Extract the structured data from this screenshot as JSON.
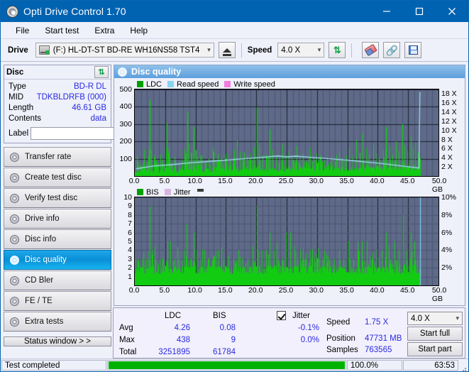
{
  "window": {
    "title": "Opti Drive Control 1.70",
    "app_icon": "disc-icon",
    "minimize": "–",
    "maximize": "□",
    "close": "✕"
  },
  "menu": {
    "items": [
      "File",
      "Start test",
      "Extra",
      "Help"
    ]
  },
  "toolbar": {
    "drive_label": "Drive",
    "drive_value": "(F:)  HL-DT-ST BD-RE  WH16NS58 TST4",
    "eject_icon": "eject-icon",
    "speed_label": "Speed",
    "speed_value": "4.0 X",
    "refresh_icon": "refresh-icon",
    "eraser_icon": "eraser-icon",
    "chain_icon": "chain-icon",
    "save_icon": "save-icon"
  },
  "disc": {
    "header": "Disc",
    "refresh_icon": "refresh-icon",
    "rows": [
      {
        "key": "Type",
        "value": "BD-R DL"
      },
      {
        "key": "MID",
        "value": "TDKBLDRFB (000)"
      },
      {
        "key": "Length",
        "value": "46.61 GB"
      },
      {
        "key": "Contents",
        "value": "data"
      }
    ],
    "label_key": "Label",
    "label_value": "",
    "cd_icon": "cd-icon"
  },
  "sidebar": {
    "items": [
      {
        "label": "Transfer rate",
        "selected": false
      },
      {
        "label": "Create test disc",
        "selected": false
      },
      {
        "label": "Verify test disc",
        "selected": false
      },
      {
        "label": "Drive info",
        "selected": false
      },
      {
        "label": "Disc info",
        "selected": false
      },
      {
        "label": "Disc quality",
        "selected": true
      },
      {
        "label": "CD Bler",
        "selected": false
      },
      {
        "label": "FE / TE",
        "selected": false
      },
      {
        "label": "Extra tests",
        "selected": false
      }
    ],
    "status_button": "Status window > >"
  },
  "quality": {
    "header_icon": "disc-icon",
    "header": "Disc quality"
  },
  "chart_data": [
    {
      "type": "area",
      "title": "LDC / Read speed",
      "xlabel": "GB",
      "ylabel": "LDC",
      "legend": [
        {
          "name": "LDC",
          "color": "#00a000"
        },
        {
          "name": "Read speed",
          "color": "#87d3f0"
        },
        {
          "name": "Write speed",
          "color": "#f07ce0"
        }
      ],
      "legend_position": "top-left",
      "grid": true,
      "xlim": [
        0,
        50
      ],
      "xticks": [
        "0.0",
        "5.0",
        "10.0",
        "15.0",
        "20.0",
        "25.0",
        "30.0",
        "35.0",
        "40.0",
        "45.0",
        "50.0"
      ],
      "xunit": "GB",
      "ylim": [
        0,
        500
      ],
      "yticks": [
        "100",
        "200",
        "300",
        "400",
        "500"
      ],
      "y2lim": [
        0,
        19
      ],
      "y2ticks": [
        "2 X",
        "4 X",
        "6 X",
        "8 X",
        "10 X",
        "12 X",
        "14 X",
        "16 X",
        "18 X"
      ],
      "data_extent_gb": 47.0,
      "ldc": {
        "baseline": 30,
        "peaks": [
          {
            "x": 0.4,
            "y": 120
          },
          {
            "x": 0.9,
            "y": 70
          },
          {
            "x": 1.4,
            "y": 60
          },
          {
            "x": 2.0,
            "y": 80
          },
          {
            "x": 2.45,
            "y": 438
          },
          {
            "x": 2.7,
            "y": 150
          },
          {
            "x": 3.1,
            "y": 110
          },
          {
            "x": 3.6,
            "y": 65
          },
          {
            "x": 4.2,
            "y": 95
          },
          {
            "x": 4.8,
            "y": 60
          },
          {
            "x": 5.3,
            "y": 305
          },
          {
            "x": 5.6,
            "y": 160
          },
          {
            "x": 6.0,
            "y": 75
          },
          {
            "x": 6.6,
            "y": 110
          },
          {
            "x": 7.2,
            "y": 70
          },
          {
            "x": 7.8,
            "y": 95
          },
          {
            "x": 8.2,
            "y": 155
          },
          {
            "x": 8.6,
            "y": 372
          },
          {
            "x": 8.9,
            "y": 190
          },
          {
            "x": 9.3,
            "y": 130
          },
          {
            "x": 9.7,
            "y": 285
          },
          {
            "x": 10.1,
            "y": 150
          },
          {
            "x": 10.5,
            "y": 90
          },
          {
            "x": 11.0,
            "y": 120
          },
          {
            "x": 11.6,
            "y": 75
          },
          {
            "x": 12.2,
            "y": 100
          },
          {
            "x": 12.8,
            "y": 170
          },
          {
            "x": 13.3,
            "y": 85
          },
          {
            "x": 13.9,
            "y": 95
          },
          {
            "x": 14.5,
            "y": 70
          },
          {
            "x": 15.1,
            "y": 130
          },
          {
            "x": 15.6,
            "y": 90
          },
          {
            "x": 16.2,
            "y": 110
          },
          {
            "x": 16.8,
            "y": 205
          },
          {
            "x": 17.3,
            "y": 140
          },
          {
            "x": 17.9,
            "y": 85
          },
          {
            "x": 18.4,
            "y": 120
          },
          {
            "x": 19.0,
            "y": 95
          },
          {
            "x": 19.6,
            "y": 165
          },
          {
            "x": 20.1,
            "y": 395
          },
          {
            "x": 20.5,
            "y": 175
          },
          {
            "x": 21.0,
            "y": 120
          },
          {
            "x": 21.6,
            "y": 95
          },
          {
            "x": 22.2,
            "y": 270
          },
          {
            "x": 22.7,
            "y": 150
          },
          {
            "x": 23.2,
            "y": 110
          },
          {
            "x": 23.8,
            "y": 85
          },
          {
            "x": 24.3,
            "y": 185
          },
          {
            "x": 24.9,
            "y": 120
          },
          {
            "x": 25.4,
            "y": 145
          },
          {
            "x": 26.0,
            "y": 95
          },
          {
            "x": 26.6,
            "y": 175
          },
          {
            "x": 27.1,
            "y": 110
          },
          {
            "x": 27.7,
            "y": 130
          },
          {
            "x": 28.3,
            "y": 90
          },
          {
            "x": 28.9,
            "y": 160
          },
          {
            "x": 29.4,
            "y": 100
          },
          {
            "x": 30.0,
            "y": 75
          },
          {
            "x": 30.6,
            "y": 125
          },
          {
            "x": 31.2,
            "y": 90
          },
          {
            "x": 31.8,
            "y": 70
          },
          {
            "x": 32.4,
            "y": 110
          },
          {
            "x": 33.0,
            "y": 85
          },
          {
            "x": 33.6,
            "y": 140
          },
          {
            "x": 34.2,
            "y": 95
          },
          {
            "x": 34.8,
            "y": 120
          },
          {
            "x": 35.3,
            "y": 170
          },
          {
            "x": 35.9,
            "y": 100
          },
          {
            "x": 36.4,
            "y": 210
          },
          {
            "x": 37.0,
            "y": 135
          },
          {
            "x": 37.5,
            "y": 245
          },
          {
            "x": 38.1,
            "y": 160
          },
          {
            "x": 38.6,
            "y": 110
          },
          {
            "x": 39.2,
            "y": 180
          },
          {
            "x": 39.8,
            "y": 130
          },
          {
            "x": 40.3,
            "y": 95
          },
          {
            "x": 40.9,
            "y": 150
          },
          {
            "x": 41.4,
            "y": 285
          },
          {
            "x": 41.9,
            "y": 170
          },
          {
            "x": 42.4,
            "y": 120
          },
          {
            "x": 43.0,
            "y": 200
          },
          {
            "x": 43.5,
            "y": 145
          },
          {
            "x": 44.0,
            "y": 300
          },
          {
            "x": 44.4,
            "y": 175
          },
          {
            "x": 44.9,
            "y": 120
          },
          {
            "x": 45.4,
            "y": 230
          },
          {
            "x": 45.8,
            "y": 160
          },
          {
            "x": 46.2,
            "y": 195
          },
          {
            "x": 46.6,
            "y": 140
          }
        ]
      },
      "read_speed": {
        "note": "rises 1.6X to ~4.4X near 23GB then declines to ~1.7X at 47GB, vertical jump at end",
        "points": [
          {
            "x": 0.2,
            "y": 1.6
          },
          {
            "x": 3.0,
            "y": 2.2
          },
          {
            "x": 6.0,
            "y": 2.5
          },
          {
            "x": 9.0,
            "y": 2.9
          },
          {
            "x": 12.0,
            "y": 3.2
          },
          {
            "x": 15.0,
            "y": 3.5
          },
          {
            "x": 18.0,
            "y": 3.8
          },
          {
            "x": 21.0,
            "y": 4.1
          },
          {
            "x": 23.5,
            "y": 4.4
          },
          {
            "x": 25.0,
            "y": 4.2
          },
          {
            "x": 26.5,
            "y": 4.35
          },
          {
            "x": 29.0,
            "y": 4.1
          },
          {
            "x": 32.0,
            "y": 3.8
          },
          {
            "x": 35.0,
            "y": 3.5
          },
          {
            "x": 38.0,
            "y": 3.1
          },
          {
            "x": 41.0,
            "y": 2.7
          },
          {
            "x": 44.0,
            "y": 2.2
          },
          {
            "x": 46.8,
            "y": 1.75
          },
          {
            "x": 46.95,
            "y": 18.5
          }
        ]
      }
    },
    {
      "type": "area",
      "title": "BIS / Jitter",
      "xlabel": "GB",
      "ylabel": "BIS",
      "legend": [
        {
          "name": "BIS",
          "color": "#00a000"
        },
        {
          "name": "Jitter",
          "color": "#d8b4e0"
        }
      ],
      "legend_position": "top-left",
      "grid": true,
      "xlim": [
        0,
        50
      ],
      "xticks": [
        "0.0",
        "5.0",
        "10.0",
        "15.0",
        "20.0",
        "25.0",
        "30.0",
        "35.0",
        "40.0",
        "45.0",
        "50.0"
      ],
      "xunit": "GB",
      "ylim": [
        0,
        10
      ],
      "yticks": [
        "1",
        "2",
        "3",
        "4",
        "5",
        "6",
        "7",
        "8",
        "9",
        "10"
      ],
      "y2lim": [
        0,
        10
      ],
      "y2ticks": [
        "2%",
        "4%",
        "6%",
        "8%",
        "10%"
      ],
      "data_extent_gb": 47.0,
      "bis": {
        "baseline": 1.8,
        "peaks": [
          {
            "x": 0.5,
            "y": 3
          },
          {
            "x": 1.2,
            "y": 3
          },
          {
            "x": 1.9,
            "y": 3
          },
          {
            "x": 2.5,
            "y": 9
          },
          {
            "x": 2.9,
            "y": 4
          },
          {
            "x": 3.4,
            "y": 3
          },
          {
            "x": 4.1,
            "y": 3
          },
          {
            "x": 4.7,
            "y": 3
          },
          {
            "x": 5.4,
            "y": 5
          },
          {
            "x": 5.8,
            "y": 5
          },
          {
            "x": 6.5,
            "y": 3
          },
          {
            "x": 7.2,
            "y": 3
          },
          {
            "x": 8.5,
            "y": 7
          },
          {
            "x": 9.1,
            "y": 3
          },
          {
            "x": 9.7,
            "y": 6
          },
          {
            "x": 10.2,
            "y": 4
          },
          {
            "x": 10.9,
            "y": 3
          },
          {
            "x": 11.5,
            "y": 4
          },
          {
            "x": 12.2,
            "y": 3
          },
          {
            "x": 13.0,
            "y": 3
          },
          {
            "x": 13.8,
            "y": 4
          },
          {
            "x": 14.6,
            "y": 3
          },
          {
            "x": 15.4,
            "y": 3
          },
          {
            "x": 16.2,
            "y": 3
          },
          {
            "x": 17.0,
            "y": 4
          },
          {
            "x": 17.8,
            "y": 3
          },
          {
            "x": 18.6,
            "y": 3
          },
          {
            "x": 19.4,
            "y": 3
          },
          {
            "x": 20.1,
            "y": 9
          },
          {
            "x": 20.9,
            "y": 4
          },
          {
            "x": 21.6,
            "y": 4
          },
          {
            "x": 22.2,
            "y": 6
          },
          {
            "x": 22.9,
            "y": 4
          },
          {
            "x": 23.6,
            "y": 3
          },
          {
            "x": 24.3,
            "y": 3
          },
          {
            "x": 24.9,
            "y": 6
          },
          {
            "x": 25.6,
            "y": 6
          },
          {
            "x": 26.4,
            "y": 4
          },
          {
            "x": 27.2,
            "y": 4
          },
          {
            "x": 28.0,
            "y": 3
          },
          {
            "x": 28.8,
            "y": 4
          },
          {
            "x": 29.6,
            "y": 3
          },
          {
            "x": 30.4,
            "y": 3
          },
          {
            "x": 31.2,
            "y": 4
          },
          {
            "x": 32.0,
            "y": 3
          },
          {
            "x": 32.8,
            "y": 3
          },
          {
            "x": 33.6,
            "y": 4
          },
          {
            "x": 34.4,
            "y": 3
          },
          {
            "x": 35.2,
            "y": 5
          },
          {
            "x": 36.0,
            "y": 3
          },
          {
            "x": 36.8,
            "y": 4
          },
          {
            "x": 37.4,
            "y": 5
          },
          {
            "x": 38.2,
            "y": 5
          },
          {
            "x": 39.0,
            "y": 3
          },
          {
            "x": 39.8,
            "y": 4
          },
          {
            "x": 40.6,
            "y": 4
          },
          {
            "x": 41.3,
            "y": 6
          },
          {
            "x": 42.0,
            "y": 3
          },
          {
            "x": 42.7,
            "y": 5
          },
          {
            "x": 43.5,
            "y": 4
          },
          {
            "x": 44.2,
            "y": 8
          },
          {
            "x": 44.8,
            "y": 4
          },
          {
            "x": 45.4,
            "y": 6
          },
          {
            "x": 46.0,
            "y": 5
          },
          {
            "x": 46.5,
            "y": 3
          }
        ]
      }
    }
  ],
  "stats": {
    "col_ldc": "LDC",
    "col_bis": "BIS",
    "jitter_label": "Jitter",
    "jitter_checked": true,
    "rows": [
      {
        "name": "Avg",
        "ldc": "4.26",
        "bis": "0.08",
        "jitter": "-0.1%"
      },
      {
        "name": "Max",
        "ldc": "438",
        "bis": "9",
        "jitter": "0.0%"
      },
      {
        "name": "Total",
        "ldc": "3251895",
        "bis": "61784",
        "jitter": ""
      }
    ],
    "speed_label": "Speed",
    "speed_value": "1.75 X",
    "position_label": "Position",
    "position_value": "47731 MB",
    "samples_label": "Samples",
    "samples_value": "763565",
    "speed_select": "4.0 X",
    "start_full": "Start full",
    "start_part": "Start part"
  },
  "statusbar": {
    "message": "Test completed",
    "progress_percent": "100.0%",
    "progress_value": 100,
    "elapsed": "63:53"
  },
  "colors": {
    "titlebar": "#0063b1",
    "accent": "#2a2ae0",
    "plot_bg": "#5e6a88",
    "ldc_green": "#00c000",
    "read_speed": "#87d3f0",
    "write_speed": "#f07ce0",
    "jitter": "#d8b4e0",
    "progress": "#00b200",
    "selected_nav": "#0a8fd6"
  }
}
